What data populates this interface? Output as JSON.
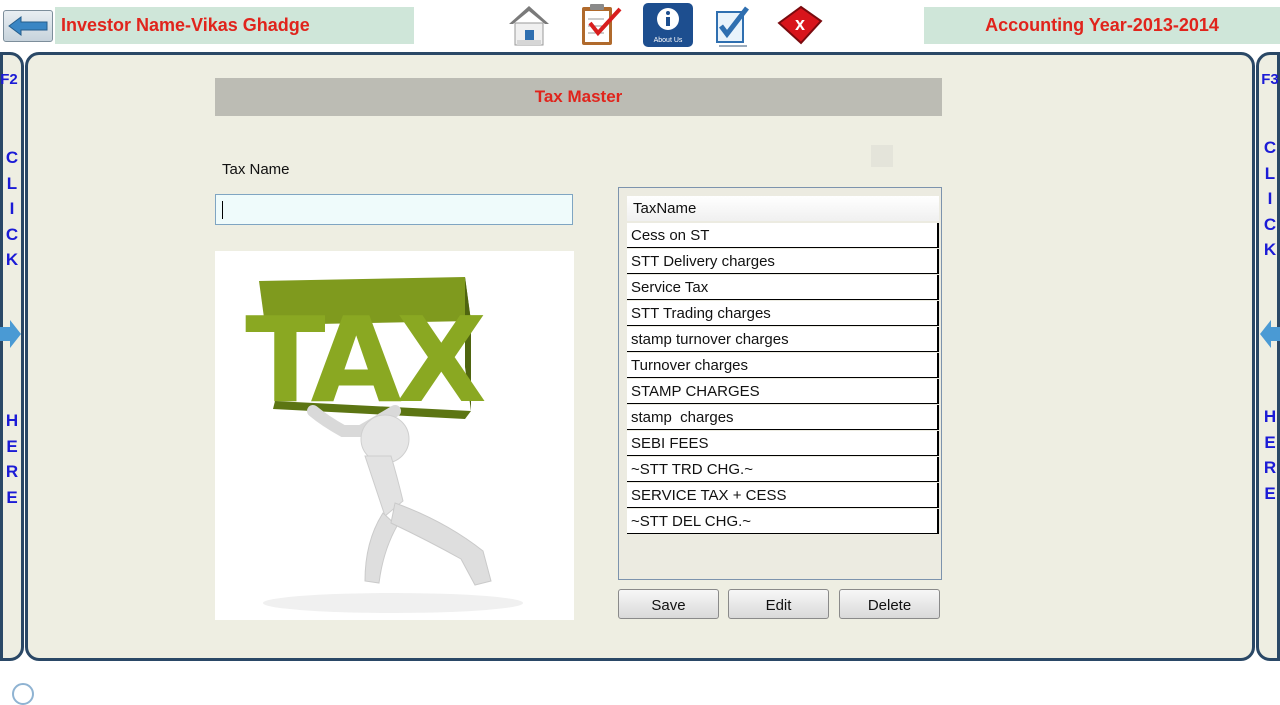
{
  "header": {
    "investor": "Investor Name-Vikas Ghadge",
    "accounting_year": "Accounting Year-2013-2014",
    "toolbar": {
      "about_label": "About Us",
      "icons": [
        "arrow-left-icon",
        "home-icon",
        "clipboard-check-icon",
        "info-icon",
        "edit-icon",
        "close-icon"
      ]
    }
  },
  "side_left": {
    "key": "F2",
    "word1": [
      "C",
      "L",
      "I",
      "C",
      "K"
    ],
    "word2": [
      "H",
      "E",
      "R",
      "E"
    ]
  },
  "side_right": {
    "key": "F3",
    "word1": [
      "C",
      "L",
      "I",
      "C",
      "K"
    ],
    "word2": [
      "H",
      "E",
      "R",
      "E"
    ]
  },
  "form": {
    "title": "Tax Master",
    "tax_name_label": "Tax Name",
    "tax_name_value": "",
    "image_text": "TAX"
  },
  "grid": {
    "column": "TaxName",
    "rows": [
      "Cess on ST",
      "STT Delivery charges",
      "Service Tax",
      "STT Trading charges",
      "stamp turnover charges",
      "Turnover charges",
      "STAMP CHARGES",
      "stamp  charges",
      "SEBI FEES",
      "~STT TRD CHG.~",
      "SERVICE TAX + CESS",
      "~STT DEL CHG.~"
    ]
  },
  "buttons": {
    "save": "Save",
    "edit": "Edit",
    "delete": "Delete"
  },
  "colors": {
    "accent_red": "#e0241c",
    "panel_bg": "#eeeee2",
    "frame": "#2a4866",
    "side_text": "#1b1bd6"
  }
}
